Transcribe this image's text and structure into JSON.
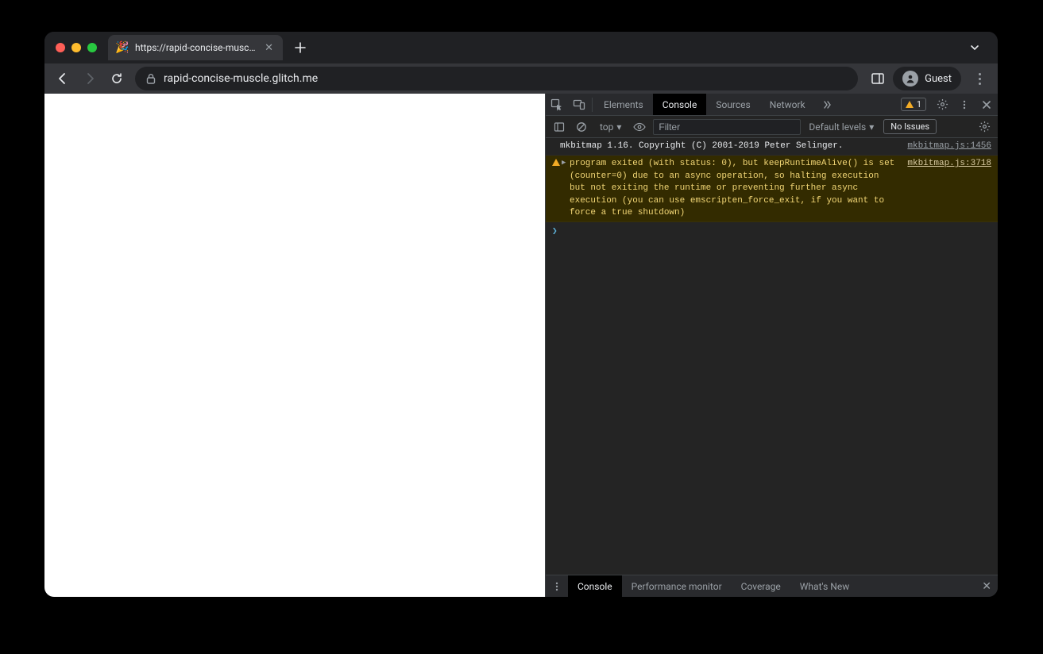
{
  "tab": {
    "favicon": "🎉",
    "title": "https://rapid-concise-muscle.g"
  },
  "omnibox": {
    "url": "rapid-concise-muscle.glitch.me"
  },
  "profile": {
    "label": "Guest"
  },
  "devtools": {
    "tabs": {
      "elements": "Elements",
      "console": "Console",
      "sources": "Sources",
      "network": "Network"
    },
    "warning_count": "1",
    "console_bar": {
      "context": "top",
      "filter_placeholder": "Filter",
      "levels": "Default levels",
      "issues": "No Issues"
    },
    "logs": [
      {
        "type": "info",
        "msg": "mkbitmap 1.16. Copyright (C) 2001-2019 Peter Selinger.",
        "src": "mkbitmap.js:1456"
      },
      {
        "type": "warn",
        "msg": "program exited (with status: 0), but keepRuntimeAlive() is set (counter=0) due to an async operation, so halting execution but not exiting the runtime or preventing further async execution (you can use emscripten_force_exit, if you want to force a true shutdown)",
        "src": "mkbitmap.js:3718"
      }
    ],
    "drawer": {
      "console": "Console",
      "perf": "Performance monitor",
      "coverage": "Coverage",
      "whatsnew": "What's New"
    }
  }
}
